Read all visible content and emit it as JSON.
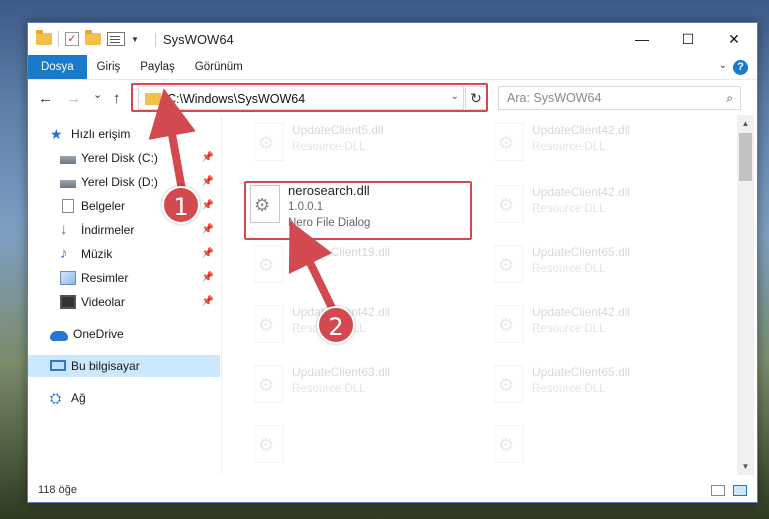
{
  "window": {
    "title": "SysWOW64",
    "minimize": "—",
    "maximize": "☐",
    "close": "✕"
  },
  "ribbon": {
    "tabs": [
      {
        "label": "Dosya",
        "active": true
      },
      {
        "label": "Giriş"
      },
      {
        "label": "Paylaş"
      },
      {
        "label": "Görünüm"
      }
    ],
    "help": "?"
  },
  "nav": {
    "back": "←",
    "forward": "→",
    "recent": "⌄",
    "up": "↑",
    "address": "C:\\Windows\\SysWOW64",
    "refresh": "↻",
    "search_placeholder": "Ara: SysWOW64"
  },
  "sidebar": {
    "items": [
      {
        "label": "Hızlı erişim",
        "icon": "star-icon"
      },
      {
        "label": "Yerel Disk (C:)",
        "icon": "drive-icon",
        "pinned": true
      },
      {
        "label": "Yerel Disk (D:)",
        "icon": "drive-icon",
        "pinned": true
      },
      {
        "label": "Belgeler",
        "icon": "document-icon",
        "pinned": true
      },
      {
        "label": "İndirmeler",
        "icon": "download-icon",
        "pinned": true
      },
      {
        "label": "Müzik",
        "icon": "music-icon",
        "pinned": true
      },
      {
        "label": "Resimler",
        "icon": "pictures-icon",
        "pinned": true
      },
      {
        "label": "Videolar",
        "icon": "video-icon",
        "pinned": true
      },
      {
        "label": "OneDrive",
        "icon": "cloud-icon"
      },
      {
        "label": "Bu bilgisayar",
        "icon": "computer-icon",
        "selected": true
      },
      {
        "label": "Ağ",
        "icon": "network-icon"
      }
    ]
  },
  "files": {
    "highlighted": {
      "name": "nerosearch.dll",
      "version": "1.0.0.1",
      "description": "Nero File Dialog"
    },
    "faded": [
      {
        "name": "UpdateClient5.dll",
        "description": "Resource DLL"
      },
      {
        "name": "UpdateClient42.dll",
        "description": "Resource DLL"
      },
      {
        "name": "UpdateClient42.dll",
        "description": "Resource DLL"
      },
      {
        "name": "UpdateClient19.dll",
        "description": "Resource DLL"
      },
      {
        "name": "UpdateClient65.dll",
        "description": "Resource DLL"
      },
      {
        "name": "UpdateClient42.dll",
        "description": "Resource DLL"
      },
      {
        "name": "UpdateClient42.dll",
        "description": "Resource DLL"
      },
      {
        "name": "UpdateClient63.dll",
        "description": "Resource DLL"
      },
      {
        "name": "UpdateClient65.dll",
        "description": "Resource DLL"
      }
    ]
  },
  "status": {
    "item_count": "118 öğe"
  },
  "annotations": {
    "callout1": "1",
    "callout2": "2",
    "color": "#d24a4f"
  }
}
